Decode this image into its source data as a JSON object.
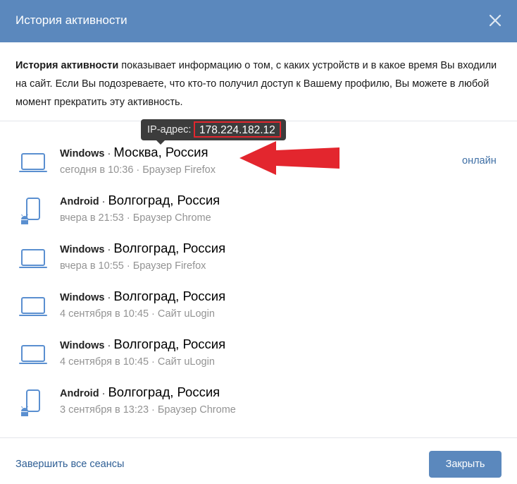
{
  "header": {
    "title": "История активности",
    "close_icon": "close-icon"
  },
  "intro": {
    "bold": "История активности",
    "text": " показывает информацию о том, с каких устройств и в какое время Вы входили на сайт. Если Вы подозреваете, что кто-то получил доступ к Вашему профилю, Вы можете в любой момент прекратить эту активность."
  },
  "tooltip": {
    "label": "IP-адрес:",
    "ip": "178.224.182.12"
  },
  "sessions": [
    {
      "os": "Windows",
      "sep": " · ",
      "city": "Москва, Россия",
      "meta": "сегодня в 10:36 · Браузер Firefox",
      "status": "онлайн",
      "device": "laptop-icon"
    },
    {
      "os": "Android",
      "sep": " · ",
      "city": "Волгоград, Россия",
      "meta": "вчера в 21:53 · Браузер Chrome",
      "status": "",
      "device": "android-phone-icon"
    },
    {
      "os": "Windows",
      "sep": " · ",
      "city": "Волгоград, Россия",
      "meta": "вчера в 10:55 · Браузер Firefox",
      "status": "",
      "device": "laptop-icon"
    },
    {
      "os": "Windows",
      "sep": " · ",
      "city": "Волгоград, Россия",
      "meta": "4 сентября в 10:45 · Сайт uLogin",
      "status": "",
      "device": "laptop-icon"
    },
    {
      "os": "Windows",
      "sep": " · ",
      "city": "Волгоград, Россия",
      "meta": "4 сентября в 10:45 · Сайт uLogin",
      "status": "",
      "device": "laptop-icon"
    },
    {
      "os": "Android",
      "sep": " · ",
      "city": "Волгоград, Россия",
      "meta": "3 сентября в 13:23 · Браузер Chrome",
      "status": "",
      "device": "android-phone-icon"
    }
  ],
  "footer": {
    "end_all": "Завершить все сеансы",
    "close_btn": "Закрыть"
  },
  "colors": {
    "header": "#5b88bd",
    "accent": "#3f6fa5",
    "annotation": "#e3262e"
  }
}
